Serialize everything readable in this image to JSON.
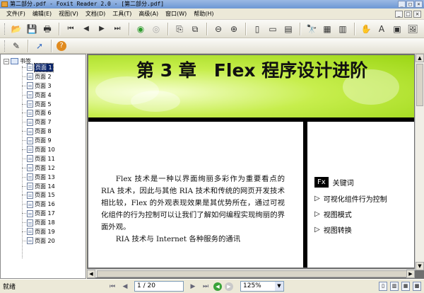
{
  "window": {
    "title": "第二部分.pdf - Foxit Reader 2.0 - [第二部分.pdf]",
    "controls": [
      "_",
      "□",
      "×"
    ]
  },
  "menu": [
    "文件(F)",
    "编辑(E)",
    "视图(V)",
    "文档(D)",
    "工具(T)",
    "高级(A)",
    "窗口(W)",
    "帮助(H)"
  ],
  "toolbar1": [
    {
      "icon": "open-folder-icon",
      "glyph": "📂"
    },
    {
      "icon": "save-icon",
      "glyph": "💾"
    },
    {
      "icon": "print-icon",
      "glyph": "🖶"
    },
    {
      "icon": "first-page-icon",
      "glyph": "⏮"
    },
    {
      "icon": "previous-page-icon",
      "glyph": "◀"
    },
    {
      "icon": "next-page-icon",
      "glyph": "▶"
    },
    {
      "icon": "last-page-icon",
      "glyph": "⏭"
    },
    {
      "icon": "back-icon",
      "glyph": "◉"
    },
    {
      "icon": "forward-icon",
      "glyph": "◎"
    },
    {
      "icon": "copy-icon",
      "glyph": "⎘"
    },
    {
      "icon": "paste-icon",
      "glyph": "⧉"
    },
    {
      "icon": "zoom-out-icon",
      "glyph": "⊖"
    },
    {
      "icon": "zoom-in-icon",
      "glyph": "⊕"
    },
    {
      "icon": "actual-size-icon",
      "glyph": "▯"
    },
    {
      "icon": "fit-page-icon",
      "glyph": "▭"
    },
    {
      "icon": "fit-width-icon",
      "glyph": "▤"
    },
    {
      "icon": "find-icon",
      "glyph": "🔭"
    },
    {
      "icon": "single-page-icon",
      "glyph": "▦"
    },
    {
      "icon": "continuous-icon",
      "glyph": "▥"
    },
    {
      "icon": "hand-tool-icon",
      "glyph": "✋"
    },
    {
      "icon": "select-text-icon",
      "glyph": "A"
    },
    {
      "icon": "snapshot-icon",
      "glyph": "▣"
    },
    {
      "icon": "image-icon",
      "glyph": "🖼"
    }
  ],
  "toolbar2": [
    {
      "icon": "edit-tool-icon",
      "glyph": "✎"
    },
    {
      "icon": "arrow-tool-icon",
      "glyph": "➚"
    },
    {
      "icon": "help-icon",
      "glyph": "?"
    }
  ],
  "bookmarks": {
    "root_label": "书签",
    "toggle": "−",
    "items": [
      "页面 1",
      "页面 2",
      "页面 3",
      "页面 4",
      "页面 5",
      "页面 6",
      "页面 7",
      "页面 8",
      "页面 9",
      "页面 10",
      "页面 11",
      "页面 12",
      "页面 13",
      "页面 14",
      "页面 15",
      "页面 16",
      "页面 17",
      "页面 18",
      "页面 19",
      "页面 20"
    ],
    "selected_index": 0
  },
  "document": {
    "chapter_title": "第 3 章　Flex 程序设计进阶",
    "paragraph1": "Flex 技术是一种以界面绚丽多彩作为重要看点的 RIA 技术，因此与其他 RIA 技术和传统的网页开发技术相比较，Flex 的外观表现效果是其优势所在，通过可视化组件的行为控制可以让我们了解如何编程实现绚丽的界面外观。",
    "paragraph2": "RIA 技术与 Internet 各种服务的通讯",
    "keywords_badge": "Fx",
    "keywords_title": "关键词",
    "keywords": [
      "可视化组件行为控制",
      "视图模式",
      "视图转换"
    ]
  },
  "status": {
    "text": "就绪",
    "page_indicator": "1 / 20",
    "zoom": "125%"
  },
  "colors": {
    "banner": "#b6e32e",
    "selection": "#0a246a",
    "viewer_bg": "#6f6f6f"
  }
}
